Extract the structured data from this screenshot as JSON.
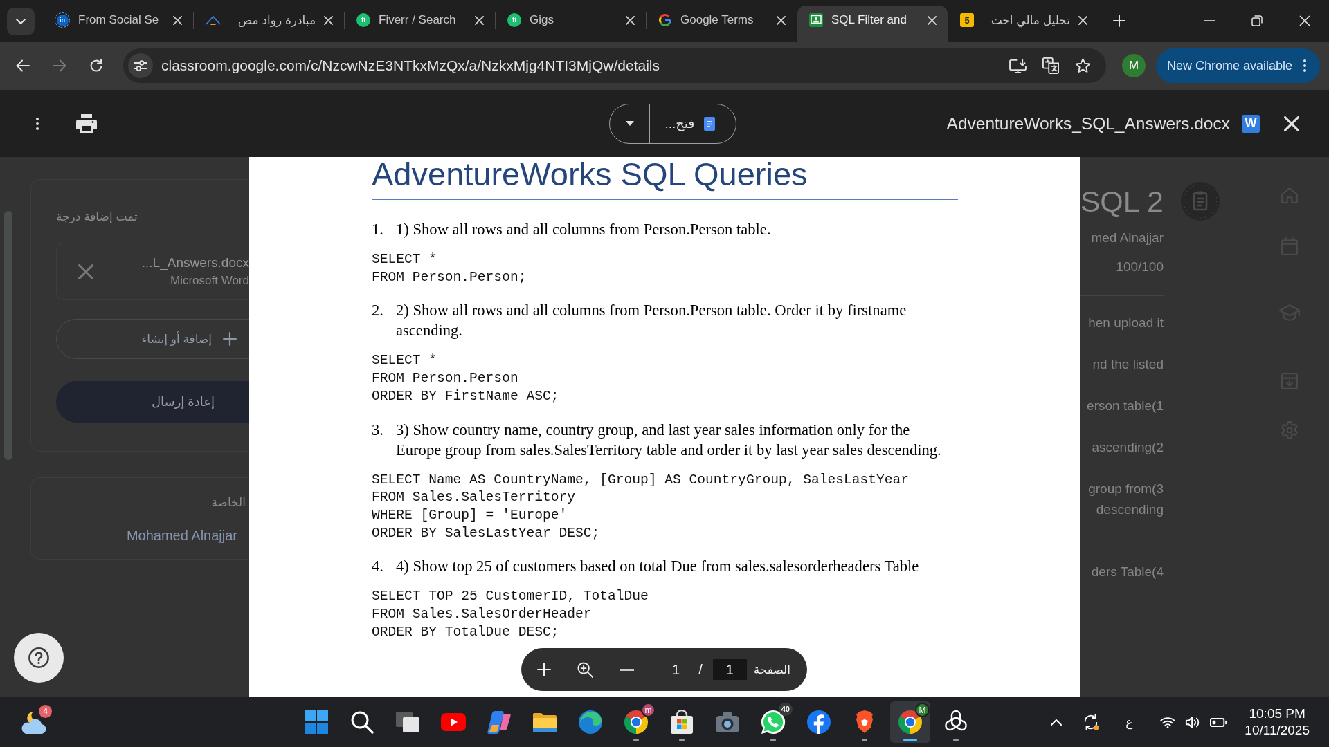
{
  "browser": {
    "tabs": [
      {
        "title": "From Social Se",
        "icon_text": "in",
        "selected": false
      },
      {
        "title": "مبادرة رواد مص",
        "selected": false
      },
      {
        "title": "Fiverr / Search",
        "icon_text": "fi",
        "selected": false
      },
      {
        "title": "Gigs",
        "icon_text": "fi",
        "selected": false
      },
      {
        "title": "Google Terms",
        "selected": false
      },
      {
        "title": "SQL Filter and",
        "selected": true
      },
      {
        "title": "تحليل مالي احت",
        "icon_text": "5",
        "selected": false
      }
    ],
    "nav_buttons": [
      {
        "disabled": false
      },
      {
        "disabled": true
      },
      {
        "disabled": false
      }
    ],
    "address_bar": {
      "url": "classroom.google.com/c/NzcwNzE3NTkxMzQx/a/NzkxMjg4NTI3MjQw/details"
    },
    "profile": {
      "initial": "M"
    },
    "update_button": {
      "label": "New Chrome available"
    }
  },
  "viewer": {
    "open_button": {
      "label": "فتح..."
    },
    "file_name": "AdventureWorks_SQL_Answers.docx",
    "file_badge": "W"
  },
  "classroom": {
    "left_panel": {
      "status": "تمت إضافة درجة",
      "attachment": {
        "name": "...L_Answers.docx",
        "type": "Microsoft Word"
      },
      "add_button": "إضافة أو إنشاء",
      "resubmit_button": "إعادة إرسال",
      "private_comments": {
        "heading": "الخاصة",
        "author": "Mohamed Alnajjar"
      }
    },
    "right_panel": {
      "title": "SQL 2",
      "author": "med Alnajjar",
      "points": "100/100",
      "description": [
        {
          "lines": [
            "hen upload it"
          ]
        },
        {
          "lines": [
            "nd the listed"
          ]
        },
        {
          "lines": [
            "erson table(1"
          ]
        },
        {
          "lines": [
            "ascending(2"
          ]
        },
        {
          "lines": [
            "group from(3",
            "descending"
          ]
        },
        {
          "lines": [
            "ders Table(4"
          ]
        }
      ]
    }
  },
  "document": {
    "title": "AdventureWorks SQL Queries",
    "items": [
      {
        "number": "1.",
        "text": "1) Show all rows and all columns from Person.Person table.",
        "code": [
          "SELECT *",
          "FROM Person.Person;"
        ]
      },
      {
        "number": "2.",
        "text": "2) Show all rows and all columns from Person.Person table. Order it by firstname ascending.",
        "code": [
          "SELECT *",
          "FROM Person.Person",
          "ORDER BY FirstName ASC;"
        ]
      },
      {
        "number": "3.",
        "text": "3) Show country name, country group, and last year sales information only for the Europe group from sales.SalesTerritory table and order it by last year sales descending.",
        "code": [
          "SELECT Name AS CountryName, [Group] AS CountryGroup, SalesLastYear",
          "FROM Sales.SalesTerritory",
          "WHERE [Group] = 'Europe'",
          "ORDER BY SalesLastYear DESC;"
        ]
      },
      {
        "number": "4.",
        "text": "4) Show top 25 of customers based on total Due from sales.salesorderheaders Table",
        "code": [
          "SELECT TOP 25 CustomerID, TotalDue",
          "FROM Sales.SalesOrderHeader",
          "ORDER BY TotalDue DESC;"
        ]
      }
    ]
  },
  "pager": {
    "label": "الصفحة",
    "current_page": "1",
    "separator": "/",
    "page_count": "1"
  },
  "taskbar": {
    "weather": {
      "badge": {
        "text": "4",
        "kind": "count",
        "color": "#e5626a"
      }
    },
    "apps": [
      {
        "running": false,
        "active": false
      },
      {
        "running": false,
        "active": false
      },
      {
        "running": false,
        "active": false
      },
      {
        "running": false,
        "active": false
      },
      {
        "running": false,
        "active": false
      },
      {
        "running": false,
        "active": false
      },
      {
        "running": false,
        "active": false
      },
      {
        "running": true,
        "active": false,
        "badge": {
          "text": "m",
          "kind": "avatar",
          "color": "#b8466f"
        }
      },
      {
        "running": true,
        "active": false
      },
      {
        "running": false,
        "active": false
      },
      {
        "running": true,
        "active": false,
        "badge": {
          "text": "40",
          "kind": "count",
          "color": "#3a3a3a"
        }
      },
      {
        "running": false,
        "active": false
      },
      {
        "running": true,
        "active": false
      },
      {
        "running": true,
        "active": true,
        "badge": {
          "text": "M",
          "kind": "avatar",
          "color": "#2e7d32"
        }
      },
      {
        "running": true,
        "active": false
      }
    ],
    "tray": {
      "input_language": "ع",
      "time": "10:05 PM",
      "date": "10/11/2025"
    }
  }
}
